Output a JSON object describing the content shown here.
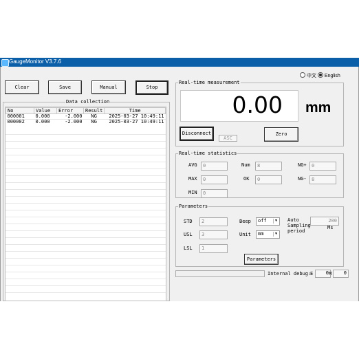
{
  "window": {
    "title": "GaugeMonitor V3.7.6"
  },
  "language": {
    "option_cn": "中文",
    "option_en": "English",
    "selected": "English"
  },
  "toolbar": {
    "clear": "Clear",
    "save": "Save",
    "manual": "Manual",
    "stop": "Stop"
  },
  "data_collection": {
    "title": "Data collection",
    "columns": [
      "No",
      "Value",
      "Error",
      "Result",
      "Time"
    ],
    "rows": [
      [
        "000001",
        "0.000",
        "-2.000",
        "NG",
        "2025-03-27 10:49:11"
      ],
      [
        "000002",
        "0.000",
        "-2.000",
        "NG",
        "2025-03-27 10:49:11"
      ]
    ]
  },
  "measurement": {
    "title": "Real-time measurement",
    "value": "0.00",
    "unit": "mm",
    "disconnect": "Disconnect",
    "mode": "ASC",
    "zero": "Zero"
  },
  "statistics": {
    "title": "Real-time statistics",
    "avg_label": "AVG",
    "avg": "0",
    "num_label": "Num",
    "num": "8",
    "ngplus_label": "NG+",
    "ngplus": "0",
    "max_label": "MAX",
    "max": "0",
    "ok_label": "OK",
    "ok": "0",
    "ngminus_label": "NG-",
    "ngminus": "8",
    "min_label": "MIN",
    "min": "0"
  },
  "parameters": {
    "title": "Parameters",
    "std_label": "STD",
    "std": "2",
    "beep_label": "Beep",
    "beep": "off",
    "auto_label_1": "Auto",
    "auto_label_2": "Sampling",
    "auto_label_3": "period",
    "auto_value": "200",
    "auto_unit": "Ms",
    "usl_label": "USL",
    "usl": "3",
    "unit_label": "Unit",
    "unit": "mm",
    "lsl_label": "LSL",
    "lsl": "1",
    "button": "Parameters"
  },
  "debug": {
    "label": "Internal debug:",
    "e_label": "E",
    "e": "0",
    "m_label": "M",
    "m": "0"
  }
}
